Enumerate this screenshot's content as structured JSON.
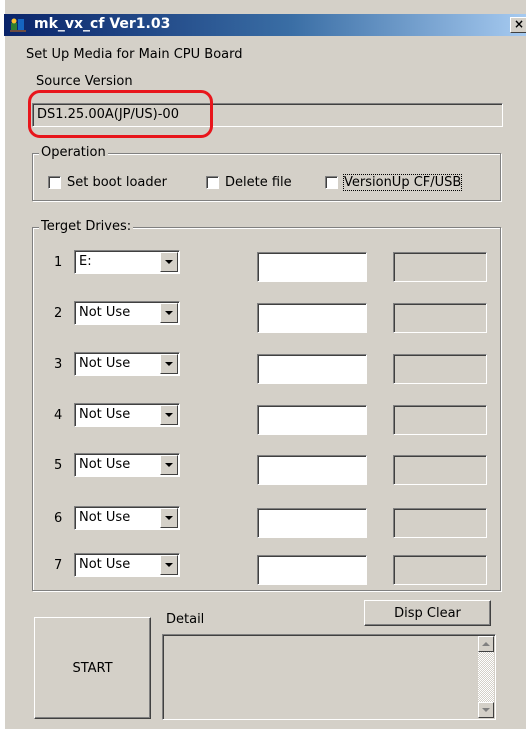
{
  "window": {
    "title": "mk_vx_cf Ver1.03",
    "app_icon": "app-icon",
    "close_glyph": "×",
    "subtitle": "Set Up Media for Main CPU Board"
  },
  "source": {
    "label": "Source Version",
    "value": "DS1.25.00A(JP/US)-00",
    "highlight_color": "#e8161c"
  },
  "operation": {
    "title": "Operation",
    "options": [
      {
        "label": "Set boot loader",
        "checked": false
      },
      {
        "label": "Delete file",
        "checked": false
      },
      {
        "label": "VersionUp CF/USB",
        "checked": false
      }
    ]
  },
  "target": {
    "title": "Terget Drives:",
    "drives": [
      {
        "num": "1",
        "value": "E:"
      },
      {
        "num": "2",
        "value": "Not Use"
      },
      {
        "num": "3",
        "value": "Not Use"
      },
      {
        "num": "4",
        "value": "Not Use"
      },
      {
        "num": "5",
        "value": "Not Use"
      },
      {
        "num": "6",
        "value": "Not Use"
      },
      {
        "num": "7",
        "value": "Not Use"
      }
    ]
  },
  "bottom": {
    "start_label": "START",
    "detail_label": "Detail",
    "disp_clear_label": "Disp Clear"
  },
  "colors": {
    "face": "#d4d0c8",
    "titlebar_start": "#0a246a",
    "titlebar_end": "#a6caf0"
  }
}
